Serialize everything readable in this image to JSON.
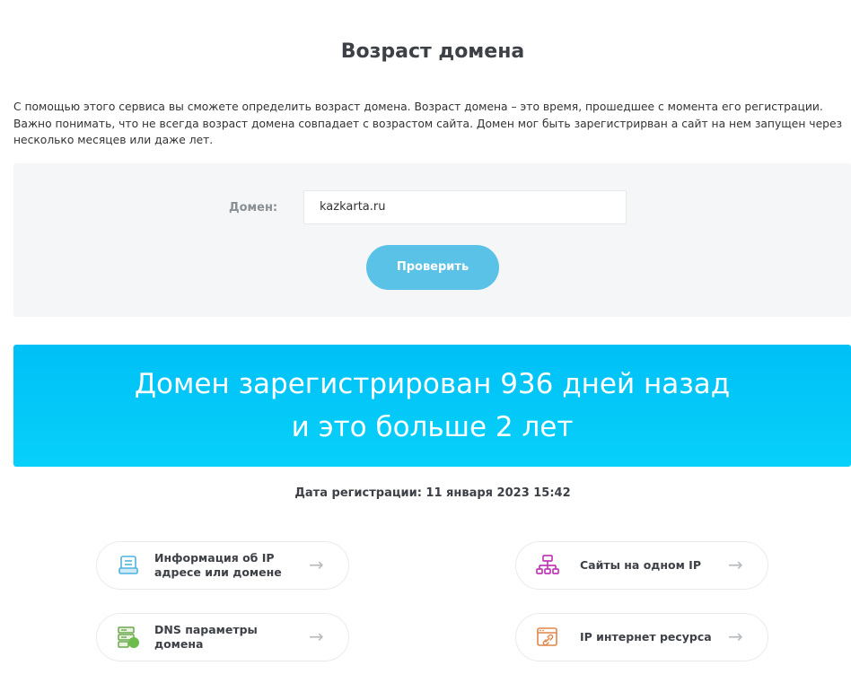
{
  "page": {
    "title": "Возраст домена",
    "intro": "С помощью этого сервиса вы сможете определить возраст домена. Возраст домена – это время, прошедшее с момента его регистрации. Важно понимать, что не всегда возраст домена совпадает с возрастом сайта. Домен мог быть зарегистрирван а сайт на нем запущен через несколько месяцев или даже лет."
  },
  "form": {
    "label": "Домен:",
    "value": "kazkarta.ru",
    "button": "Проверить"
  },
  "result": {
    "line1": "Домен зарегистрирован 936 дней назад",
    "line2": "и это больше 2 лет"
  },
  "registration": "Дата регистрации: 11 января 2023 15:42",
  "links": [
    {
      "label": "Информация об IP адресе или домене",
      "icon": "server-info-icon",
      "arrow": "→"
    },
    {
      "label": "Сайты на одном IP",
      "icon": "sitemap-icon",
      "arrow": "→"
    },
    {
      "label": "DNS параметры домена",
      "icon": "dns-server-icon",
      "arrow": "→"
    },
    {
      "label": "IP интернет ресурса",
      "icon": "browser-link-icon",
      "arrow": "→"
    }
  ],
  "colors": {
    "banner": "#00c0f6",
    "button": "#5bc2e7",
    "panel": "#f4f6f7"
  }
}
